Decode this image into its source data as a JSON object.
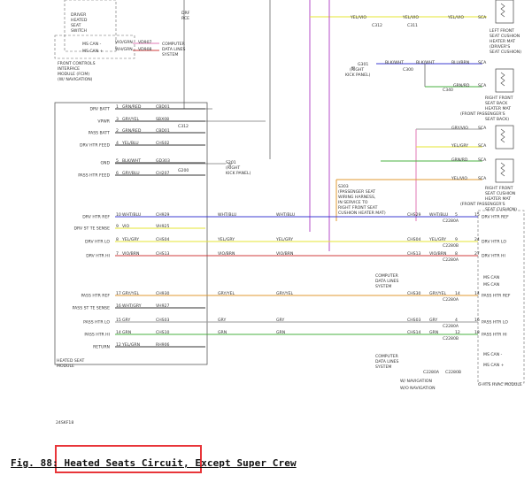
{
  "colors": {
    "yellow": "#e6e633",
    "violet": "#b64dc8",
    "blue": "#3c3cd2",
    "red": "#d23c3c",
    "orange": "#e09a30",
    "green": "#4ab040",
    "pink": "#e07ab4",
    "gray": "#9a9a9a",
    "black": "#333333",
    "highlight": "#e8363a"
  },
  "caption": {
    "text": "Fig. 88: Heated Seats Circuit, Except Super Crew",
    "highlight_region": "Fig. 88: Heated Seats Circuit,"
  },
  "labels": {
    "driver_switch": [
      "DRIVER",
      "HEATED",
      "SEAT",
      "SWITCH"
    ],
    "fcim": [
      "FRONT CONTROLS",
      "INTERFACE",
      "MODULE (FCIM)",
      "(W/ NAVIGATION)"
    ],
    "ms_can_minus": "MS CAN -",
    "ms_can_plus": "MS CAN +",
    "vw_wire": "VIO/GRN",
    "wh_wire": "WH/GRN",
    "vd_code_1": "VD907",
    "vd_code_2": "VD908",
    "computer_data": [
      "COMPUTER",
      "DATA LINES",
      "SYSTEM"
    ],
    "hsm": [
      "HEATED SEAT",
      "MODULE"
    ],
    "pin_labels": [
      "DRV BATT",
      "VPWR",
      "PASS BATT",
      "DRV HTR FEED",
      "GND",
      "PASS HTR FEED",
      "DRV HTR REF",
      "DRV ST TE SENSE",
      "DRV HTR LO",
      "DRV HTR HI",
      "PASS HTR REF",
      "PASS ST TE SENSE",
      "PASS HTR LO",
      "PASS HTR HI",
      "RETURN"
    ],
    "pin_numbers": [
      "1",
      "3",
      "2",
      "4",
      "5",
      "6",
      "10",
      "9",
      "8",
      "7",
      "17",
      "16",
      "15",
      "14",
      "12"
    ],
    "left_wires": [
      "GRN/RED",
      "GRY/YEL",
      "GRN/RED",
      "YEL/BLU",
      "BLK/WHT",
      "GRY/BLU",
      "WHT/BLU",
      "VIO",
      "YEL/GRY",
      "VIO/BRN",
      "GRY/YEL",
      "WHT/GRY",
      "GRY",
      "GRN",
      "YEL/GRN"
    ],
    "left_circuits": [
      "CBD01",
      "SBX08",
      "CBD01",
      "CHS02",
      "GD303",
      "CH207",
      "CH929",
      "VH925",
      "CHS04",
      "CHS13",
      "CH930",
      "VH927",
      "CHS03",
      "CHS10",
      "RH906"
    ],
    "right_wires": [
      "WHT/BLU",
      "YEL/GRY",
      "VIO/BRN",
      "GRY/YEL",
      "GRY",
      "GRN"
    ],
    "right_circuits": [
      "CHS29",
      "CHS04",
      "CHS13",
      "CHS30",
      "CHS03",
      "CHS14"
    ],
    "right_pins": [
      "15",
      "24",
      "27",
      "14",
      "16",
      "18"
    ],
    "rhm_pins": [
      "5",
      "9",
      "8",
      "14",
      "4",
      "12"
    ],
    "rhm_labels": [
      "DRV HTR REF",
      "DRV HTR LO",
      "DRV HTR HI",
      "PASS HTR REF",
      "PASS HTR LO",
      "PASS HTR HI"
    ],
    "c_labels": [
      "C2280A",
      "C2280B",
      "C2280A",
      "C2280A",
      "C2280A",
      "C2280B"
    ],
    "ms_can_right": "MS CAN",
    "ms_can_right_minus": "MS CAN -",
    "ms_can_right_plus": "MS CAN +",
    "rhm_title": [
      "G-HTS HVAC MODULE"
    ],
    "w_nav": "W/ NAVIGATION",
    "wo_nav": "W/O NAVIGATION",
    "c312": "C312",
    "c300": "C300",
    "c311": "C311",
    "c340": "C340",
    "c290": "C290",
    "c305": "C305",
    "g200": "G200",
    "s201": "S201",
    "s201_lbl": [
      "(RIGHT",
      "KICK PANEL)"
    ],
    "g301": "G301",
    "g301_lbl": [
      "(RIGHT",
      "KICK PANEL)"
    ],
    "s303": "S303",
    "s303_lbl": [
      "(PASSENGER SEAT",
      "WIRING HARNESS,",
      "IN SERVICE TO",
      "RIGHT FRONT SEAT",
      "CUSHION HEATER MAT)"
    ],
    "seat_cushion_left": [
      "LEFT FRONT",
      "SEAT CUSHION",
      "HEATER MAT",
      "(DRIVER'S",
      "SEAT CUSHION)"
    ],
    "seat_back_right": [
      "RIGHT FRONT",
      "SEAT BACK",
      "HEATER MAT",
      "(FRONT PASSENGER'S",
      "SEAT BACK)"
    ],
    "seat_cushion_right": [
      "RIGHT FRONT",
      "SEAT CUSHION",
      "HEATER MAT",
      "(FRONT PASSENGER'S",
      "SEAT CUSHION)"
    ],
    "sca": "SCA",
    "sc": "SC",
    "yel_vio": "YEL/VIO",
    "blk_wht": "BLK/WHT",
    "gry_vio": "GRY/VIO",
    "yel_gry": "YEL/GRY",
    "grn_rd": "GRN/RD",
    "blu_brn": "BLU/BRN",
    "wht_blu": "WHT/BLU",
    "drf_lbl": [
      "DRF",
      "RCE"
    ],
    "corner_code": "24SKF18"
  }
}
